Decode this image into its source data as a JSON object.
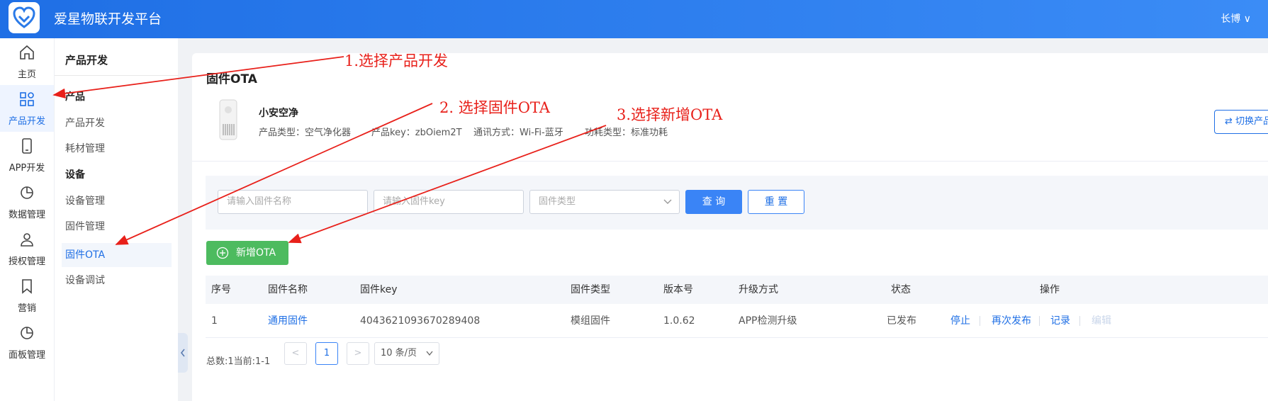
{
  "header": {
    "app_title": "爱星物联开发平台",
    "user": "长博 ∨"
  },
  "rail": [
    {
      "label": "主页",
      "icon": "home-icon"
    },
    {
      "label": "产品开发",
      "icon": "grid-icon"
    },
    {
      "label": "APP开发",
      "icon": "phone-icon"
    },
    {
      "label": "数据管理",
      "icon": "pie-chart-icon"
    },
    {
      "label": "授权管理",
      "icon": "user-icon"
    },
    {
      "label": "营销",
      "icon": "bookmark-icon"
    },
    {
      "label": "面板管理",
      "icon": "pie-chart-icon"
    }
  ],
  "sub": {
    "title": "产品开发",
    "groups": [
      "产品",
      "设备"
    ],
    "items": [
      "产品开发",
      "耗材管理",
      "设备管理",
      "固件管理",
      "固件OTA",
      "设备调试"
    ]
  },
  "page": {
    "title": "固件OTA",
    "product_name": "小安空净",
    "meta": [
      "产品类型：空气净化器",
      "产品key：zbOiem2T",
      "通讯方式：Wi-Fi-蓝牙",
      "功耗类型：标准功耗"
    ],
    "switch_label": "切换产品"
  },
  "filter": {
    "name_placeholder": "请输入固件名称",
    "key_placeholder": "请输入固件key",
    "type_placeholder": "固件类型",
    "query": "查 询",
    "reset": "重 置"
  },
  "add_button": "新增OTA",
  "table": {
    "headers": [
      "序号",
      "固件名称",
      "固件key",
      "固件类型",
      "版本号",
      "升级方式",
      "状态",
      "操作"
    ],
    "rows": [
      {
        "no": "1",
        "name": "通用固件",
        "key": "4043621093670289408",
        "type": "模组固件",
        "version": "1.0.62",
        "upgrade": "APP检测升级",
        "status": "已发布",
        "ops": [
          "停止",
          "再次发布",
          "记录",
          "编辑"
        ]
      }
    ]
  },
  "pagination": {
    "total": "总数:1当前:1-1",
    "prev": "<",
    "page": "1",
    "next": ">",
    "size": "10 条/页"
  },
  "annotations": [
    "1.选择产品开发",
    "2. 选择固件OTA",
    "3.选择新增OTA"
  ],
  "colors": {
    "primary": "#1f6fe5",
    "success": "#4dbb5f",
    "annotation": "#e8201a"
  }
}
